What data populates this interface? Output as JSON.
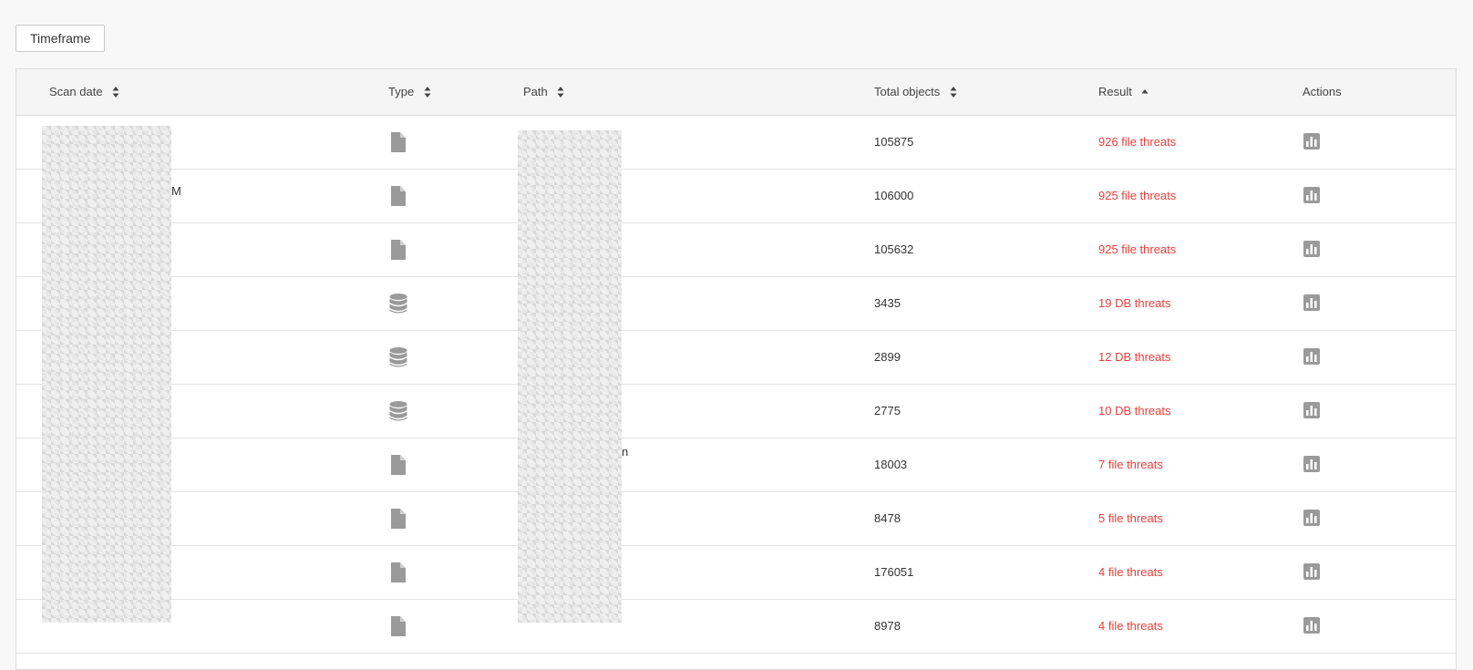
{
  "toolbar": {
    "timeframe_label": "Timeframe"
  },
  "table": {
    "headers": {
      "scan_date": "Scan date",
      "type": "Type",
      "path": "Path",
      "total_objects": "Total objects",
      "result": "Result",
      "actions": "Actions"
    },
    "rows": [
      {
        "type": "file",
        "total": "105875",
        "result": "926 file threats"
      },
      {
        "type": "file",
        "total": "106000",
        "result": "925 file threats"
      },
      {
        "type": "file",
        "total": "105632",
        "result": "925 file threats"
      },
      {
        "type": "db",
        "total": "3435",
        "result": "19 DB threats"
      },
      {
        "type": "db",
        "total": "2899",
        "result": "12 DB threats"
      },
      {
        "type": "db",
        "total": "2775",
        "result": "10 DB threats"
      },
      {
        "type": "file",
        "total": "18003",
        "result": "7 file threats"
      },
      {
        "type": "file",
        "total": "8478",
        "result": "5 file threats"
      },
      {
        "type": "file",
        "total": "176051",
        "result": "4 file threats"
      },
      {
        "type": "file",
        "total": "8978",
        "result": "4 file threats"
      }
    ],
    "partial_scan_date_suffix": "M",
    "partial_path_suffix": "n"
  },
  "icons": {
    "sort": "sort-icon",
    "sort_asc": "sort-asc-icon",
    "file": "file-icon",
    "database": "database-icon",
    "report": "bar-chart-icon"
  },
  "colors": {
    "threat": "#e8403c",
    "icon_gray": "#9a9a9a",
    "header_bg": "#f5f5f5"
  }
}
